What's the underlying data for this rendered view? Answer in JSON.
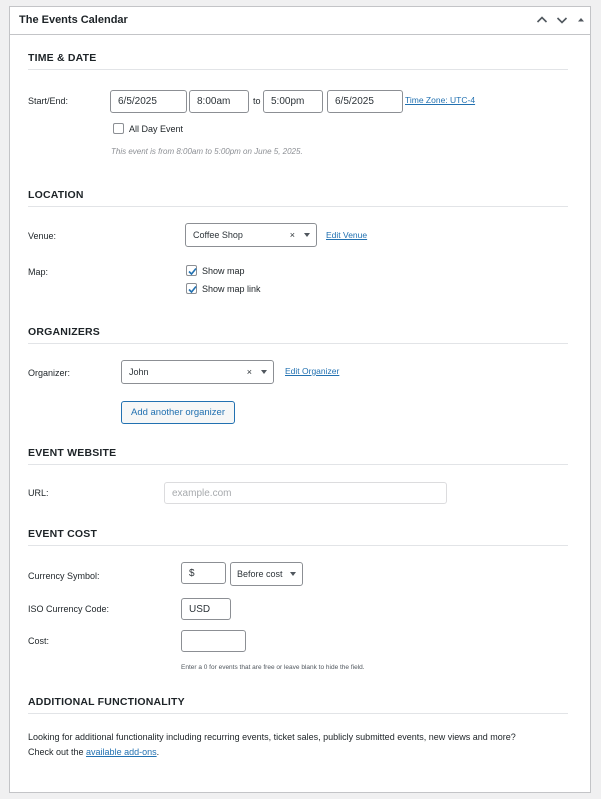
{
  "panel": {
    "title": "The Events Calendar",
    "buttons": [
      "move-up",
      "move-down",
      "toggle"
    ]
  },
  "time_date": {
    "heading": "TIME & DATE",
    "label": "Start/End:",
    "start_date": "6/5/2025",
    "start_time": "8:00am",
    "separator": "to",
    "end_time": "5:00pm",
    "end_date": "6/5/2025",
    "timezone_link": "Time Zone: UTC-4",
    "all_day_label": "All Day Event",
    "all_day_checked": false,
    "summary": "This event is from 8:00am to 5:00pm on June 5, 2025."
  },
  "location": {
    "heading": "LOCATION",
    "venue_label": "Venue:",
    "venue_value": "Coffee Shop",
    "edit_venue": "Edit Venue",
    "map_label": "Map:",
    "show_map": "Show map",
    "show_map_checked": true,
    "show_map_link": "Show map link",
    "show_map_link_checked": true
  },
  "organizers": {
    "heading": "ORGANIZERS",
    "label": "Organizer:",
    "value": "John",
    "edit_organizer": "Edit Organizer",
    "add_button": "Add another organizer"
  },
  "website": {
    "heading": "EVENT WEBSITE",
    "label": "URL:",
    "placeholder": "example.com"
  },
  "cost": {
    "heading": "EVENT COST",
    "currency_symbol_label": "Currency Symbol:",
    "currency_symbol": "$",
    "position": "Before cost",
    "iso_label": "ISO Currency Code:",
    "iso_value": "USD",
    "cost_label": "Cost:",
    "cost_value": "",
    "hint": "Enter a 0 for events that are free or leave blank to hide the field."
  },
  "additional": {
    "heading": "ADDITIONAL FUNCTIONALITY",
    "text_line1": "Looking for additional functionality including recurring events, ticket sales, publicly submitted events, new views and more?",
    "text_line2_pre": "Check out the ",
    "link": "available add-ons",
    "text_line2_post": "."
  },
  "colors": {
    "accent": "#2271b1",
    "border": "#c3c4c7",
    "background": "#f0f0f1"
  }
}
